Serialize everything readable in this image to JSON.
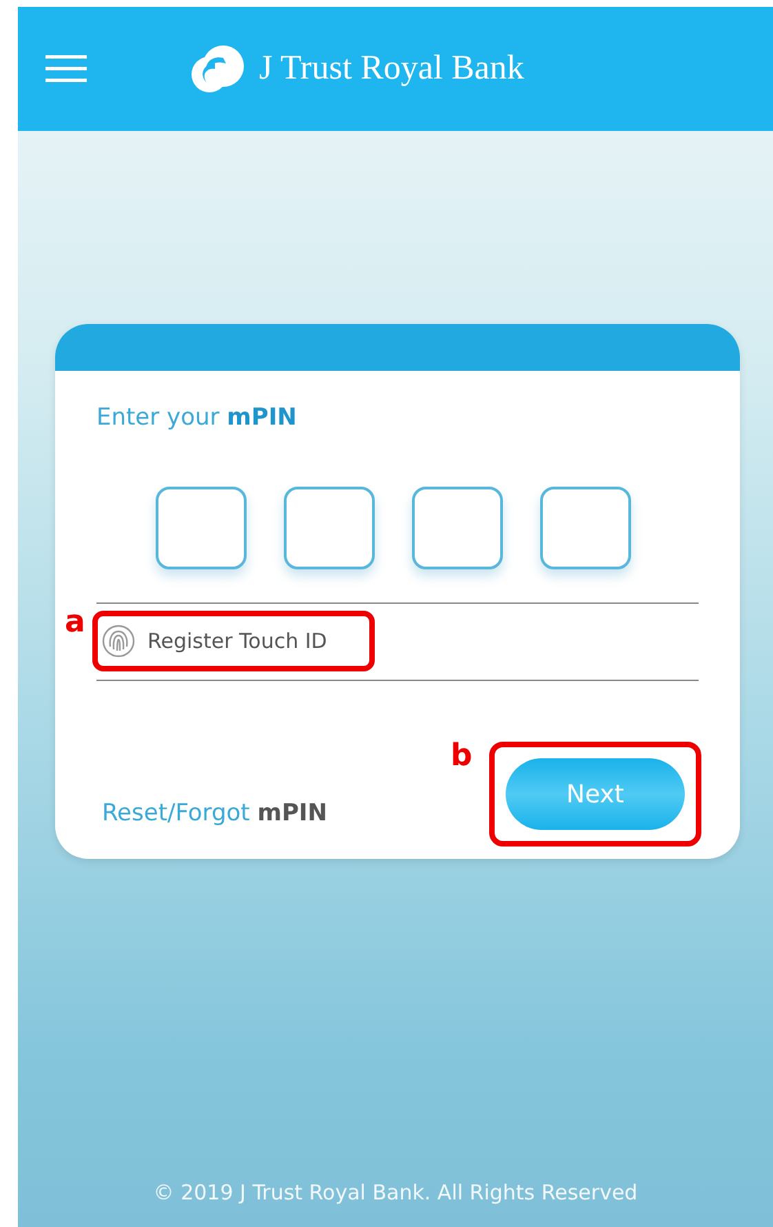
{
  "header": {
    "brand": "J Trust Royal Bank"
  },
  "login": {
    "prompt": "Enter your **mPIN**",
    "pin_boxes": [
      {
        "filled": false
      },
      {
        "filled": false
      },
      {
        "filled": false
      },
      {
        "filled": false
      }
    ],
    "touch_id": "Register Touch ID",
    "reset_link": "Reset/Forgot **mPIN**",
    "next_button": "Next"
  },
  "callouts": [
    {
      "label": "a"
    },
    {
      "label": "b"
    }
  ],
  "footer": "© 2019 J Trust Royal Bank. All Rights Reserved"
}
